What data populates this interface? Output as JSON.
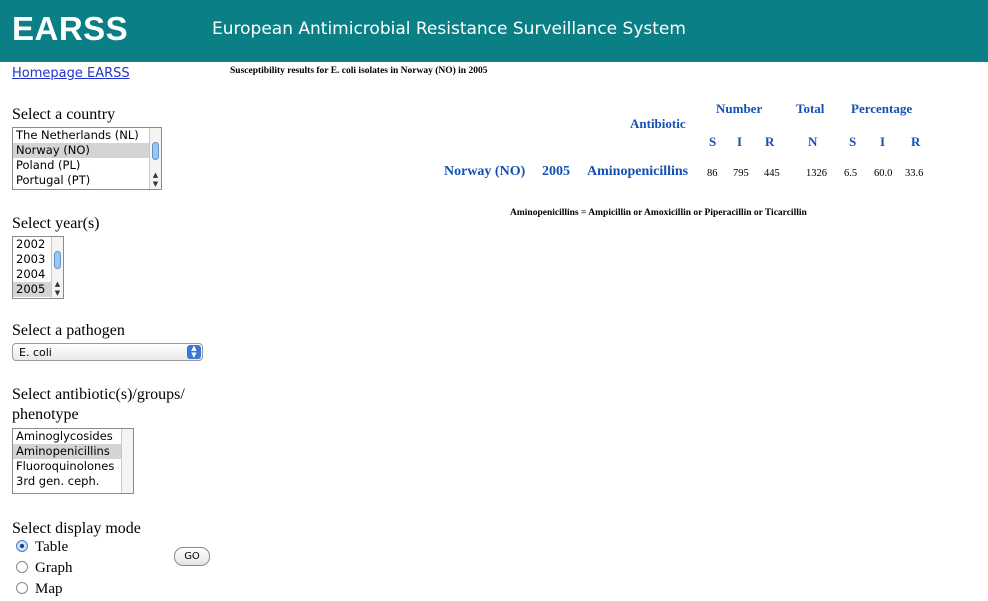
{
  "header": {
    "logo": "EARSS",
    "title": "European Antimicrobial Resistance Surveillance System"
  },
  "sidebar": {
    "homepage_link": "Homepage EARSS",
    "country": {
      "label": "Select a country",
      "options": [
        "The Netherlands (NL)",
        "Norway (NO)",
        "Poland (PL)",
        "Portugal (PT)"
      ],
      "selected": "Norway (NO)"
    },
    "year": {
      "label": "Select year(s)",
      "options": [
        "2002",
        "2003",
        "2004",
        "2005"
      ],
      "selected": "2005"
    },
    "pathogen": {
      "label": "Select a pathogen",
      "value": "E. coli"
    },
    "antibiotic": {
      "label_line1": "Select antibiotic(s)/groups/",
      "label_line2": "phenotype",
      "options": [
        "Aminoglycosides",
        "Aminopenicillins",
        "Fluoroquinolones",
        "3rd gen. ceph."
      ],
      "selected": "Aminopenicillins"
    },
    "display": {
      "label": "Select display mode",
      "options": [
        "Table",
        "Graph",
        "Map"
      ],
      "selected": "Table"
    },
    "go_button": "GO"
  },
  "results": {
    "title": "Susceptibility results for E. coli isolates in Norway (NO) in 2005",
    "headers": {
      "antibiotic": "Antibiotic",
      "number": "Number",
      "total": "Total",
      "percentage": "Percentage",
      "s": "S",
      "i": "I",
      "r": "R",
      "n": "N"
    },
    "row": {
      "country": "Norway (NO)",
      "year": "2005",
      "antibiotic": "Aminopenicillins",
      "s": "86",
      "i": "795",
      "r": "445",
      "n": "1326",
      "pct_s": "6.5",
      "pct_i": "60.0",
      "pct_r": "33.6"
    },
    "note": "Aminopenicillins = Ampicillin or Amoxicillin or Piperacillin or Ticarcillin"
  }
}
